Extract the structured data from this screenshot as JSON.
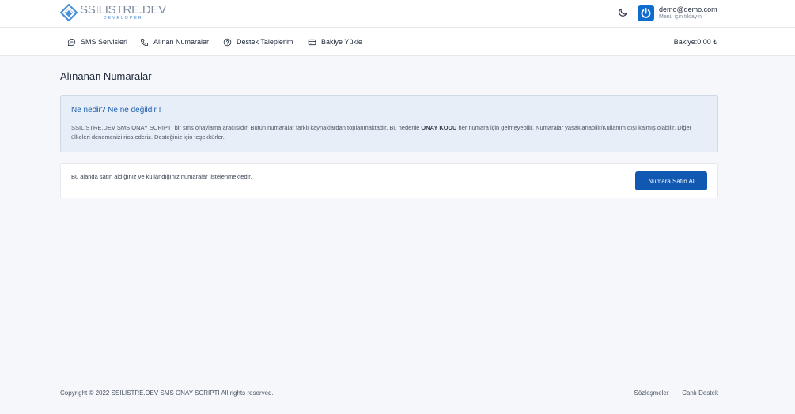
{
  "brand": {
    "name": "SSILISTRE.DEV",
    "tagline": "DEVELOPER",
    "accent": "#4a90d9"
  },
  "header": {
    "theme_icon": "moon-icon",
    "user": {
      "email": "demo@demo.com",
      "hint": "Menü için tıklayın",
      "avatar_icon": "power-icon",
      "avatar_color": "#0f6ccf"
    }
  },
  "nav": {
    "items": [
      {
        "label": "SMS Servisleri",
        "icon": "chat-icon"
      },
      {
        "label": "Alınan Numaralar",
        "icon": "phone-icon"
      },
      {
        "label": "Destek Taleplerim",
        "icon": "help-circle-icon"
      },
      {
        "label": "Bakiye Yükle",
        "icon": "credit-card-icon"
      }
    ],
    "balance": "Bakiye:0.00 ₺"
  },
  "main": {
    "title": "Alınanan Numaralar",
    "alert": {
      "title": "Ne nedir? Ne ne değildir !",
      "text_before": "SSILISTRE.DEV SMS ONAY SCRIPTI bir sms onaylama aracısıdır. Bütün numaralar farklı kaynaklardan toplanmaktadır. Bu nedenle ",
      "text_bold": "ONAY KODU",
      "text_after": " her numara için gelmeyebilir. Numaralar yasaklanabilir/Kullanım dışı kalmış olabilir. Diğer ülkeleri denemenizi rica ederiz. Desteğiniz için teşekkürler."
    },
    "card": {
      "text": "Bu alanda satın aldığınız ve kullandığınız numaralar listelenmektedir.",
      "button_label": "Numara Satın Al",
      "button_color": "#1158b3"
    }
  },
  "footer": {
    "copyright": "Copyright © 2022 SSILISTRE.DEV SMS ONAY SCRIPTI All rights reserved.",
    "links": [
      "Sözleşmeler",
      "Canlı Destek"
    ],
    "separator": "·"
  }
}
